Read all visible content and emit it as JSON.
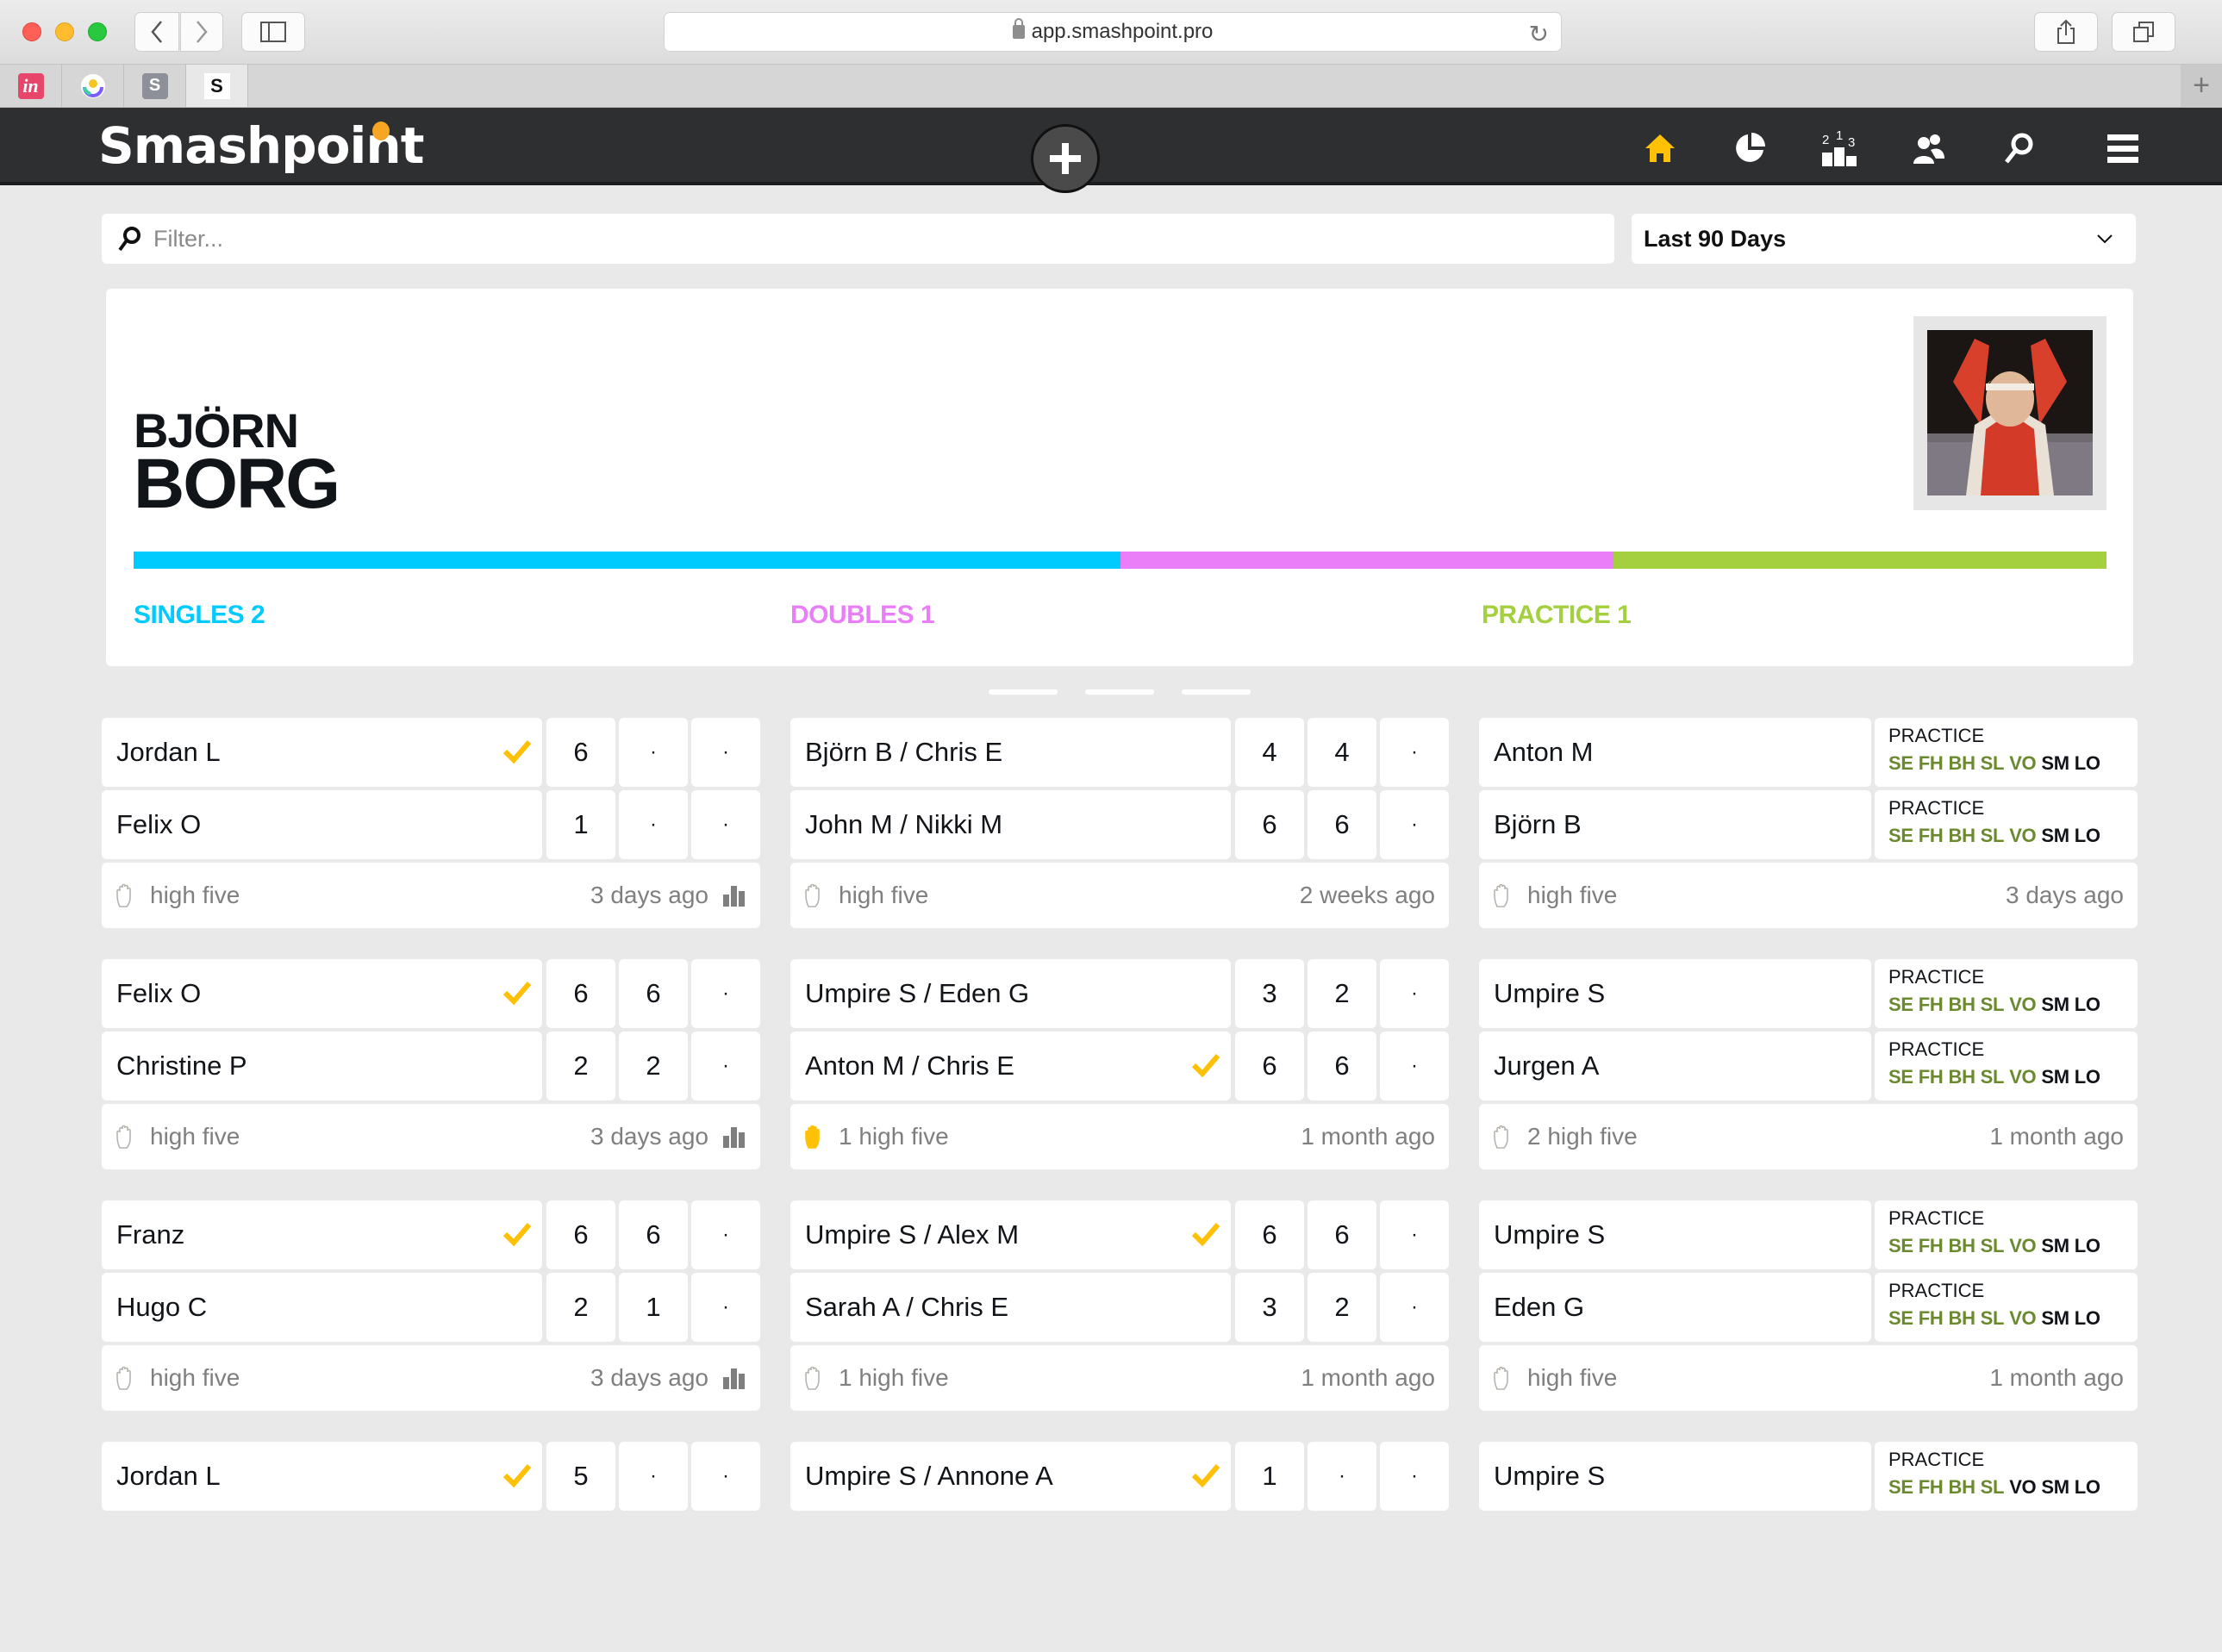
{
  "browser": {
    "url": "app.smashpoint.pro",
    "pinned_tabs": [
      {
        "icon": "invision-icon",
        "glyph": "in",
        "bg": "#e8456b",
        "fg": "#ffffff"
      },
      {
        "icon": "circle-app-icon",
        "glyph": "",
        "bg": "transparent",
        "fg": "#7b5cff"
      },
      {
        "icon": "s-app-icon",
        "glyph": "S",
        "bg": "#8e9099",
        "fg": "#ffffff"
      },
      {
        "icon": "smashpoint-icon",
        "glyph": "S",
        "bg": "#ffffff",
        "fg": "#111111"
      }
    ]
  },
  "header": {
    "logo": "Smashpoint",
    "nav": [
      {
        "name": "home",
        "active": true
      },
      {
        "name": "stats"
      },
      {
        "name": "rankings"
      },
      {
        "name": "players"
      },
      {
        "name": "search"
      },
      {
        "name": "menu"
      }
    ]
  },
  "colors": {
    "accent": "#ffc107",
    "singles": "#00cbff",
    "doubles": "#ea7ef9",
    "practice": "#a4cf3f",
    "skill_on": "#6b8a2f",
    "skill_off": "#111418"
  },
  "filter": {
    "placeholder": "Filter...",
    "value": ""
  },
  "range": {
    "selected": "Last 90 Days"
  },
  "profile": {
    "first_name": "BJÖRN",
    "last_name": "BORG",
    "categories": [
      {
        "key": "singles",
        "label": "SINGLES 2",
        "count": 2
      },
      {
        "key": "doubles",
        "label": "DOUBLES 1",
        "count": 1
      },
      {
        "key": "practice",
        "label": "PRACTICE 1",
        "count": 1
      }
    ]
  },
  "carousel": {
    "pages": 3
  },
  "columns": [
    {
      "type": "singles",
      "matches": [
        {
          "players": [
            {
              "name": "Jordan L",
              "winner": true,
              "scores": [
                "6",
                "·",
                "·"
              ]
            },
            {
              "name": "Felix O",
              "winner": false,
              "scores": [
                "1",
                "·",
                "·"
              ]
            }
          ],
          "high_five": "high five",
          "high_five_active": false,
          "when": "3 days ago",
          "stats": true
        },
        {
          "players": [
            {
              "name": "Felix O",
              "winner": true,
              "scores": [
                "6",
                "6",
                "·"
              ]
            },
            {
              "name": "Christine P",
              "winner": false,
              "scores": [
                "2",
                "2",
                "·"
              ]
            }
          ],
          "high_five": "high five",
          "high_five_active": false,
          "when": "3 days ago",
          "stats": true
        },
        {
          "players": [
            {
              "name": "Franz",
              "winner": true,
              "scores": [
                "6",
                "6",
                "·"
              ]
            },
            {
              "name": "Hugo C",
              "winner": false,
              "scores": [
                "2",
                "1",
                "·"
              ]
            }
          ],
          "high_five": "high five",
          "high_five_active": false,
          "when": "3 days ago",
          "stats": true
        },
        {
          "players": [
            {
              "name": "Jordan L",
              "winner": true,
              "scores": [
                "5",
                "·",
                "·"
              ]
            }
          ]
        }
      ]
    },
    {
      "type": "doubles",
      "matches": [
        {
          "players": [
            {
              "name": "Björn B / Chris E",
              "winner": false,
              "scores": [
                "4",
                "4",
                "·"
              ]
            },
            {
              "name": "John M / Nikki M",
              "winner": false,
              "scores": [
                "6",
                "6",
                "·"
              ]
            }
          ],
          "high_five": "high five",
          "high_five_active": false,
          "when": "2 weeks ago",
          "stats": false
        },
        {
          "players": [
            {
              "name": "Umpire S / Eden G",
              "winner": false,
              "scores": [
                "3",
                "2",
                "·"
              ]
            },
            {
              "name": "Anton M / Chris E",
              "winner": true,
              "scores": [
                "6",
                "6",
                "·"
              ]
            }
          ],
          "high_five": "1 high five",
          "high_five_active": true,
          "when": "1 month ago",
          "stats": false
        },
        {
          "players": [
            {
              "name": "Umpire S / Alex M",
              "winner": true,
              "scores": [
                "6",
                "6",
                "·"
              ]
            },
            {
              "name": "Sarah A / Chris E",
              "winner": false,
              "scores": [
                "3",
                "2",
                "·"
              ]
            }
          ],
          "high_five": "1 high five",
          "high_five_active": false,
          "when": "1 month ago",
          "stats": false
        },
        {
          "players": [
            {
              "name": "Umpire S / Annone A",
              "winner": true,
              "scores": [
                "1",
                "·",
                "·"
              ]
            }
          ]
        }
      ]
    },
    {
      "type": "practice",
      "matches": [
        {
          "players": [
            {
              "name": "Anton M",
              "practice": "PRACTICE",
              "skills_on": [
                "SE",
                "FH",
                "BH",
                "SL",
                "VO"
              ],
              "skills_off": [
                "SM",
                "LO"
              ]
            },
            {
              "name": "Björn B",
              "practice": "PRACTICE",
              "skills_on": [
                "SE",
                "FH",
                "BH",
                "SL",
                "VO"
              ],
              "skills_off": [
                "SM",
                "LO"
              ]
            }
          ],
          "high_five": "high five",
          "high_five_active": false,
          "when": "3 days ago",
          "stats": false
        },
        {
          "players": [
            {
              "name": "Umpire S",
              "practice": "PRACTICE",
              "skills_on": [
                "SE",
                "FH",
                "BH",
                "SL",
                "VO"
              ],
              "skills_off": [
                "SM",
                "LO"
              ]
            },
            {
              "name": "Jurgen A",
              "practice": "PRACTICE",
              "skills_on": [
                "SE",
                "FH",
                "BH",
                "SL",
                "VO"
              ],
              "skills_off": [
                "SM",
                "LO"
              ]
            }
          ],
          "high_five": "2 high five",
          "high_five_active": false,
          "when": "1 month ago",
          "stats": false
        },
        {
          "players": [
            {
              "name": "Umpire S",
              "practice": "PRACTICE",
              "skills_on": [
                "SE",
                "FH",
                "BH",
                "SL",
                "VO"
              ],
              "skills_off": [
                "SM",
                "LO"
              ]
            },
            {
              "name": "Eden G",
              "practice": "PRACTICE",
              "skills_on": [
                "SE",
                "FH",
                "BH",
                "SL",
                "VO"
              ],
              "skills_off": [
                "SM",
                "LO"
              ]
            }
          ],
          "high_five": "high five",
          "high_five_active": false,
          "when": "1 month ago",
          "stats": false
        },
        {
          "players": [
            {
              "name": "Umpire S",
              "practice": "PRACTICE",
              "skills_on": [
                "SE",
                "FH",
                "BH",
                "SL"
              ],
              "skills_off": [
                "VO",
                "SM",
                "LO"
              ]
            }
          ]
        }
      ]
    }
  ]
}
